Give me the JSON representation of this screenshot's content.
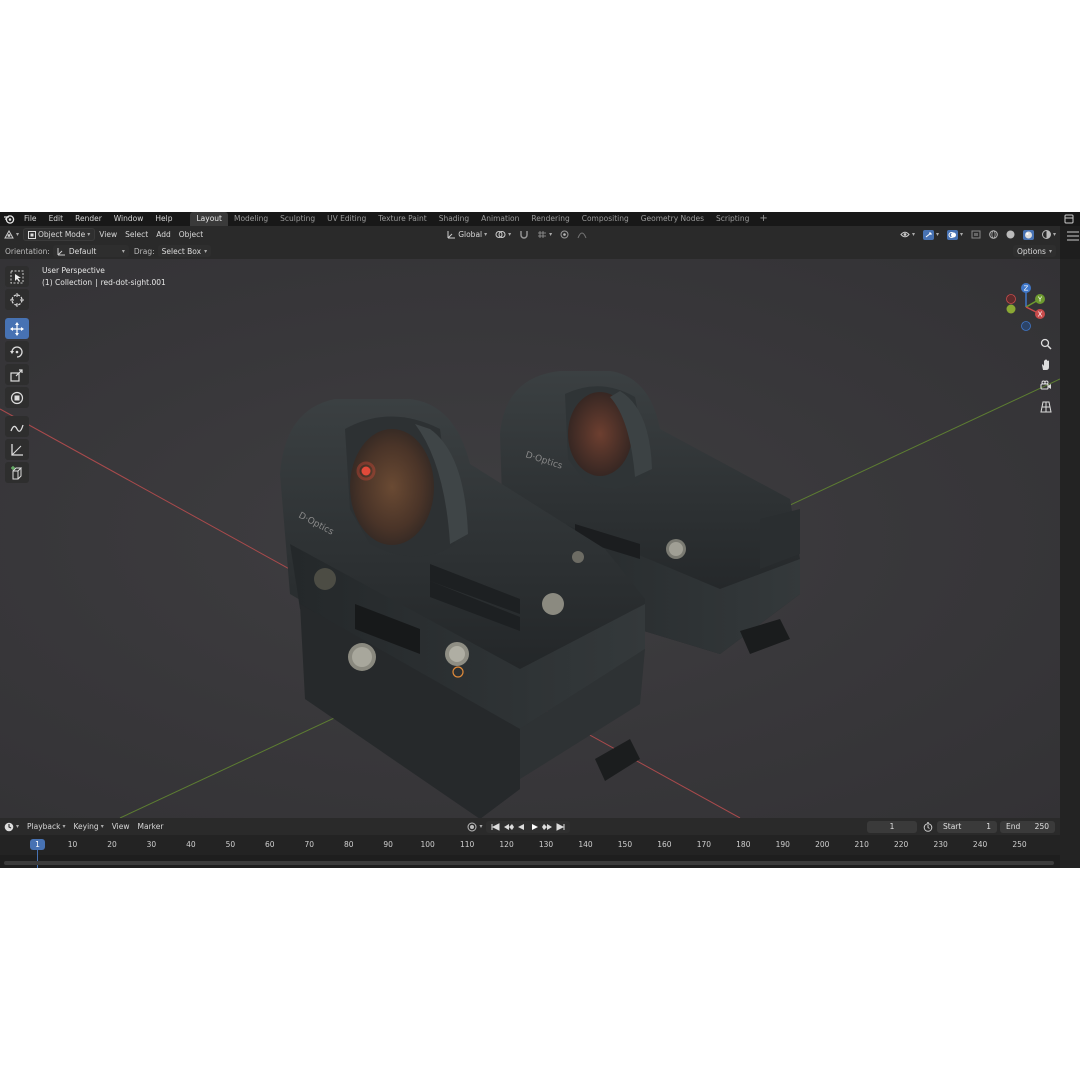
{
  "menu": {
    "items": [
      "File",
      "Edit",
      "Render",
      "Window",
      "Help"
    ]
  },
  "workspaces": {
    "tabs": [
      "Layout",
      "Modeling",
      "Sculpting",
      "UV Editing",
      "Texture Paint",
      "Shading",
      "Animation",
      "Rendering",
      "Compositing",
      "Geometry Nodes",
      "Scripting"
    ],
    "active": "Layout",
    "add_symbol": "+"
  },
  "viewport_header": {
    "mode": "Object Mode",
    "view": "View",
    "select": "Select",
    "add": "Add",
    "object": "Object",
    "transform_orientation": "Global"
  },
  "tool_settings": {
    "orientation_label": "Orientation:",
    "orientation_value": "Default",
    "drag_label": "Drag:",
    "drag_value": "Select Box",
    "options": "Options"
  },
  "viewport_overlay": {
    "perspective": "User Perspective",
    "collection": "(1) Collection",
    "separator": "|",
    "object_name": "red-dot-sight.001"
  },
  "gizmo": {
    "z": "Z",
    "y": "Y",
    "x": "X"
  },
  "timeline": {
    "playback": "Playback",
    "keying": "Keying",
    "view": "View",
    "marker": "Marker",
    "current_frame_field": "1",
    "start_label": "Start",
    "start_value": "1",
    "end_label": "End",
    "end_value": "250",
    "current_frame_marker": "1",
    "ticks": [
      "10",
      "20",
      "30",
      "40",
      "50",
      "60",
      "70",
      "80",
      "90",
      "100",
      "110",
      "120",
      "130",
      "140",
      "150",
      "160",
      "170",
      "180",
      "190",
      "200",
      "210",
      "220",
      "230",
      "240",
      "250"
    ]
  },
  "colors": {
    "accent": "#4772b3",
    "axis_x": "#c84b4b",
    "axis_y": "#6d9a2f",
    "axis_z": "#3f77c9",
    "background": "#232323"
  }
}
